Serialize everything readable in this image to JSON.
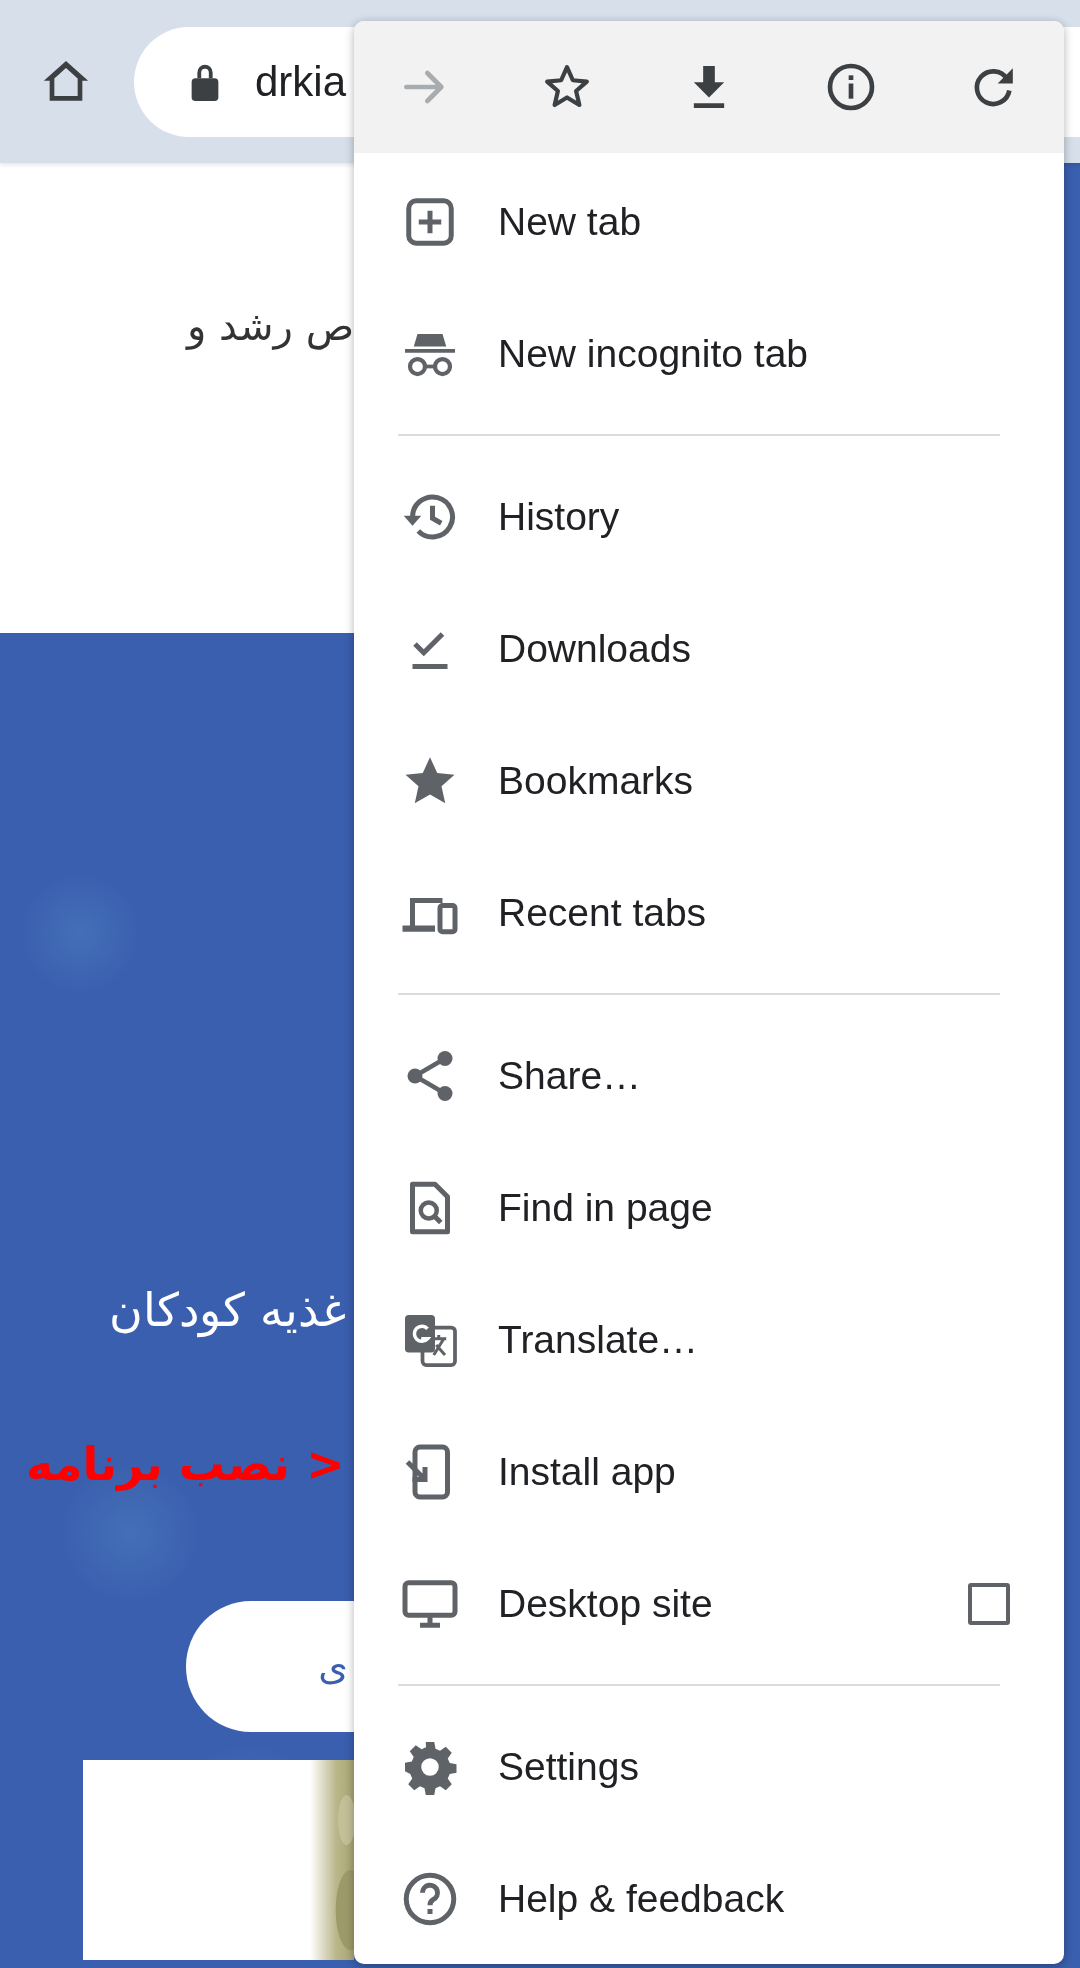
{
  "toolbar": {
    "url": "drkia"
  },
  "page": {
    "intro_text": "ص رشد و",
    "headline": "غذیه کودکان",
    "annotation": "< نصب برنامه",
    "button": "ی"
  },
  "menu": {
    "actions": [
      {
        "kind": "forward",
        "disabled": true
      },
      {
        "kind": "bookmark",
        "disabled": false
      },
      {
        "kind": "download",
        "disabled": false
      },
      {
        "kind": "info",
        "disabled": false
      },
      {
        "kind": "reload",
        "disabled": false
      }
    ],
    "sections": [
      [
        {
          "kind": "new-tab",
          "label": "New tab"
        },
        {
          "kind": "incognito",
          "label": "New incognito tab"
        }
      ],
      [
        {
          "kind": "history",
          "label": "History"
        },
        {
          "kind": "downloads",
          "label": "Downloads"
        },
        {
          "kind": "bookmarks",
          "label": "Bookmarks"
        },
        {
          "kind": "recent-tabs",
          "label": "Recent tabs"
        }
      ],
      [
        {
          "kind": "share",
          "label": "Share…"
        },
        {
          "kind": "find",
          "label": "Find in page"
        },
        {
          "kind": "translate",
          "label": "Translate…"
        },
        {
          "kind": "install",
          "label": "Install app"
        },
        {
          "kind": "desktop",
          "label": "Desktop site",
          "checked": false
        }
      ],
      [
        {
          "kind": "settings",
          "label": "Settings"
        },
        {
          "kind": "help",
          "label": "Help & feedback"
        }
      ]
    ]
  }
}
